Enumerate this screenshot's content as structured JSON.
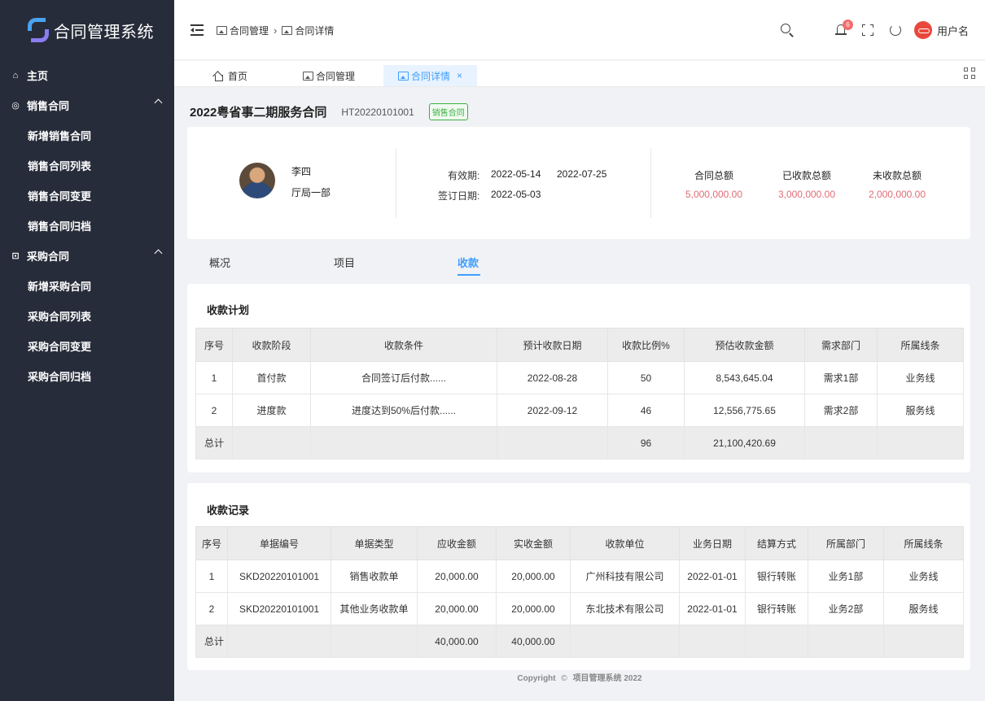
{
  "app": {
    "title": "合同管理系统"
  },
  "sidebar": {
    "home": "主页",
    "sales_group": "销售合同",
    "sales_items": [
      "新增销售合同",
      "销售合同列表",
      "销售合同变更",
      "销售合同归档"
    ],
    "purchase_group": "采购合同",
    "purchase_items": [
      "新增采购合同",
      "采购合同列表",
      "采购合同变更",
      "采购合同归档"
    ]
  },
  "header": {
    "breadcrumb": [
      "合同管理",
      "合同详情"
    ],
    "notification_count": "6",
    "username": "用户名"
  },
  "tabs": [
    {
      "label": "首页",
      "icon": "home-icon"
    },
    {
      "label": "合同管理",
      "icon": "image-icon"
    },
    {
      "label": "合同详情",
      "icon": "image-icon",
      "active": true,
      "close": "×"
    }
  ],
  "contract": {
    "title": "2022粤省事二期服务合同",
    "code": "HT20220101001",
    "tag": "销售合同"
  },
  "info": {
    "person_name": "李四",
    "person_dept": "厅局一部",
    "period_label": "有效期:",
    "period_start": "2022-05-14",
    "period_end": "2022-07-25",
    "sign_label": "签订日期:",
    "sign_date": "2022-05-03",
    "totals": [
      {
        "label": "合同总额",
        "value": "5,000,000.00"
      },
      {
        "label": "已收款总额",
        "value": "3,000,000.00"
      },
      {
        "label": "未收款总额",
        "value": "2,000,000.00"
      }
    ]
  },
  "subtabs": [
    "概况",
    "项目",
    "收款"
  ],
  "plan": {
    "title": "收款计划",
    "columns": [
      "序号",
      "收款阶段",
      "收款条件",
      "预计收款日期",
      "收款比例%",
      "预估收款金额",
      "需求部门",
      "所属线条"
    ],
    "rows": [
      [
        "1",
        "首付款",
        "合同签订后付款......",
        "2022-08-28",
        "50",
        "8,543,645.04",
        "需求1部",
        "业务线"
      ],
      [
        "2",
        "进度款",
        "进度达到50%后付款......",
        "2022-09-12",
        "46",
        "12,556,775.65",
        "需求2部",
        "服务线"
      ]
    ],
    "total": [
      "总计",
      "",
      "",
      "",
      "96",
      "21,100,420.69",
      "",
      ""
    ]
  },
  "records": {
    "title": "收款记录",
    "columns": [
      "序号",
      "单据编号",
      "单据类型",
      "应收金额",
      "实收金额",
      "收款单位",
      "业务日期",
      "结算方式",
      "所属部门",
      "所属线条"
    ],
    "rows": [
      [
        "1",
        "SKD20220101001",
        "销售收款单",
        "20,000.00",
        "20,000.00",
        "广州科技有限公司",
        "2022-01-01",
        "银行转账",
        "业务1部",
        "业务线"
      ],
      [
        "2",
        "SKD20220101001",
        "其他业务收款单",
        "20,000.00",
        "20,000.00",
        "东北技术有限公司",
        "2022-01-01",
        "银行转账",
        "业务2部",
        "服务线"
      ]
    ],
    "total": [
      "总计",
      "",
      "",
      "40,000.00",
      "40,000.00",
      "",
      "",
      "",
      "",
      ""
    ]
  },
  "footer": {
    "copyright": "Copyright",
    "copy_symbol": "©",
    "text": "项目管理系统 2022"
  },
  "colors": {
    "sidebar": "#272c3a",
    "accent": "#409eff",
    "money": "#e06c75",
    "tag": "#3cb043"
  }
}
